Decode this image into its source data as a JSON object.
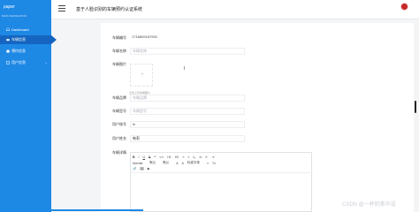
{
  "header": {
    "logo_text": "paper",
    "title": "基于人脸识别的车辆预约认证系统"
  },
  "sidebar": {
    "heading": "MAIN NAVIGATION",
    "items": [
      {
        "label": "Dashboard",
        "icon": "home-icon",
        "active": false
      },
      {
        "label": "车辆信息",
        "icon": "car-icon",
        "active": true
      },
      {
        "label": "预约信息",
        "icon": "calendar-icon",
        "active": false
      },
      {
        "label": "用户信息",
        "icon": "user-icon",
        "active": false,
        "caret": "‹"
      }
    ]
  },
  "form": {
    "plate_no_label": "车辆编号",
    "plate_no_value": "1716809187952",
    "car_name_label": "车辆名称",
    "car_name_placeholder": "车辆名称",
    "car_image_label": "车辆图片",
    "upload_hint": "点击上传车辆图片",
    "car_brand_label": "车辆品牌",
    "car_brand_placeholder": "车辆品牌",
    "car_model_label": "车辆型号",
    "car_model_placeholder": "车辆型号",
    "user_account_label": "用户账号",
    "user_account_value": "hi",
    "user_name_label": "用户姓名",
    "user_name_value": "韩莉",
    "car_detail_label": "车辆详情"
  },
  "editor": {
    "row1": [
      "B",
      "I",
      "U",
      "S",
      "❝",
      "</>",
      "H1",
      "H2",
      "≡",
      "≡",
      "x₂",
      "x²",
      "⇤",
      "⇥"
    ],
    "row2": [
      "Normal",
      "默认",
      "默认",
      "A",
      "A",
      "标准字体",
      "≡",
      "Tx"
    ],
    "row3": [
      "🔗",
      "🖼",
      "▶"
    ]
  },
  "watermark": "CSDN @一杯奶茶毕设",
  "colors": {
    "sidebar": "#1e88e5",
    "sidebar_active": "#1565c0",
    "avatar": "#c62828"
  }
}
